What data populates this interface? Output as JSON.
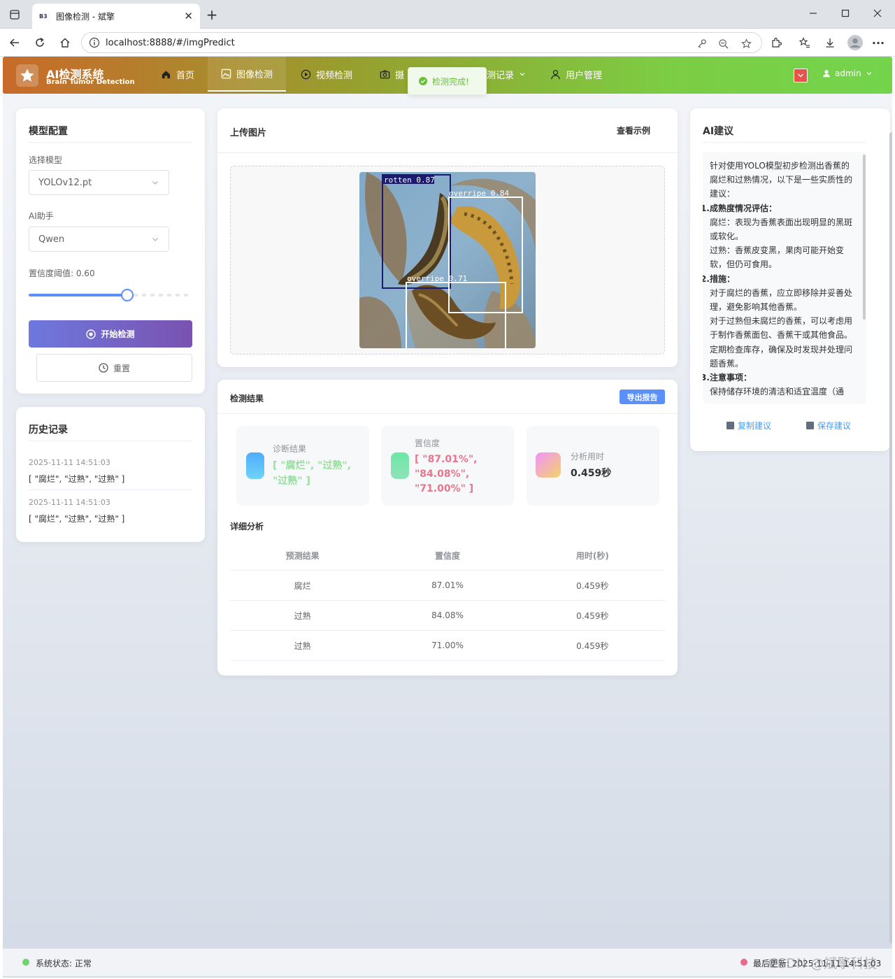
{
  "browser": {
    "tab_favicon": "B3",
    "tab_title": "图像检测 - 斌擎",
    "url": "localhost:8888/#/imgPredict"
  },
  "navbar": {
    "brand_title": "AI检测系统",
    "brand_subtitle": "Brain Tumor Detection",
    "items": [
      {
        "label": "首页",
        "icon": "home-icon"
      },
      {
        "label": "图像检测",
        "icon": "image-icon"
      },
      {
        "label": "视频检测",
        "icon": "video-play-icon"
      },
      {
        "label": "摄",
        "icon": "camera-icon"
      },
      {
        "label": "测记录",
        "icon": "chevron-down-icon"
      },
      {
        "label": "用户管理",
        "icon": "user-icon"
      }
    ],
    "user_name": "admin"
  },
  "toast": {
    "message": "检测完成!"
  },
  "model_config": {
    "title": "模型配置",
    "model_label": "选择模型",
    "model_value": "YOLOv12.pt",
    "assistant_label": "AI助手",
    "assistant_value": "Qwen",
    "threshold_label": "置信度阈值: 0.60",
    "threshold_value": 0.6,
    "start_button": "开始检测",
    "reset_button": "重置"
  },
  "history": {
    "title": "历史记录",
    "items": [
      {
        "time": "2025-11-11 14:51:03",
        "value": "[ \"腐烂\", \"过熟\", \"过熟\" ]"
      },
      {
        "time": "2025-11-11 14:51:03",
        "value": "[ \"腐烂\", \"过熟\", \"过熟\" ]"
      }
    ]
  },
  "upload": {
    "title": "上传图片",
    "example_link": "查看示例",
    "detections": [
      {
        "label": "rotten 0.87",
        "color": "#1a1a6e"
      },
      {
        "label": "overripe 0.84",
        "color": "#ffffff"
      },
      {
        "label": "overripe 0.71",
        "color": "#ffffff"
      }
    ]
  },
  "results": {
    "title": "检测结果",
    "export_button": "导出报告",
    "stats": [
      {
        "title": "诊断结果",
        "lines": [
          "[ \"腐烂\", \"过熟\",",
          "\"过熟\" ]"
        ],
        "color": "#95e09b"
      },
      {
        "title": "置信度",
        "lines": [
          "[ \"87.01%\",",
          "\"84.08%\",",
          "\"71.00%\" ]"
        ],
        "color": "#e8758e"
      },
      {
        "title": "分析用时",
        "lines": [
          "0.459秒"
        ],
        "color": "#303133"
      }
    ],
    "detail_title": "详细分析",
    "table_headers": [
      "预测结果",
      "置信度",
      "用时(秒)"
    ],
    "table_rows": [
      [
        "腐烂",
        "87.01%",
        "0.459秒"
      ],
      [
        "过熟",
        "84.08%",
        "0.459秒"
      ],
      [
        "过熟",
        "71.00%",
        "0.459秒"
      ]
    ]
  },
  "ai_advice": {
    "title": "AI建议",
    "intro": "针对使用YOLO模型初步检测出香蕉的腐烂和过熟情况，以下是一些实质性的建议：",
    "sec1_num": "1.",
    "sec1_title": "成熟度情况评估：",
    "sec1_p1": "腐烂：表现为香蕉表面出现明显的黑斑或软化。",
    "sec1_p2": "过熟：香蕉皮变黑，果肉可能开始变软，但仍可食用。",
    "sec2_num": "2.",
    "sec2_title": "措施：",
    "sec2_p1": "对于腐烂的香蕉，应立即移除并妥善处理，避免影响其他香蕉。",
    "sec2_p2": "对于过熟但未腐烂的香蕉，可以考虑用于制作香蕉面包、香蕉干或其他食品。",
    "sec2_p3": "定期检查库存，确保及时发现并处理问题香蕉。",
    "sec3_num": "3.",
    "sec3_title": "注意事项：",
    "sec3_p1": "保持储存环境的清洁和适宜温度（通",
    "copy_button": "复制建议",
    "save_button": "保存建议"
  },
  "footer": {
    "status": "系统状态: 正常",
    "last_update": "最后更新: 2025-11-11 14:51:03",
    "watermark": "CSDN @斌擎科技"
  },
  "colors": {
    "accent": "#409eff",
    "success": "#67c23a",
    "start_button": "#7163c4"
  }
}
